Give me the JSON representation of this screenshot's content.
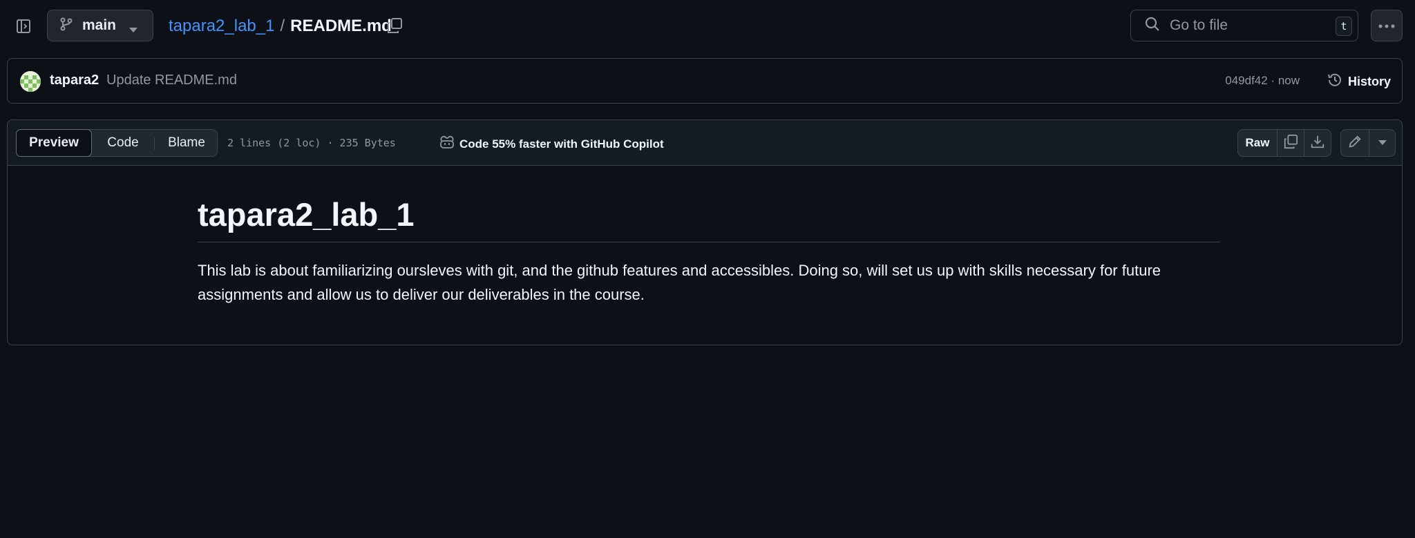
{
  "topbar": {
    "branch": "main",
    "repo_name": "tapara2_lab_1",
    "separator": "/",
    "file_name": "README.md",
    "goto_placeholder": "Go to file",
    "goto_shortcut": "t"
  },
  "commit": {
    "author": "tapara2",
    "message": "Update README.md",
    "sha": "049df42",
    "meta_separator": " · ",
    "time": "now",
    "history_label": "History"
  },
  "file_header": {
    "tabs": [
      {
        "label": "Preview",
        "active": true
      },
      {
        "label": "Code",
        "active": false
      },
      {
        "label": "Blame",
        "active": false
      }
    ],
    "stats": "2 lines (2 loc) · 235 Bytes",
    "copilot_cta": "Code 55% faster with GitHub Copilot",
    "raw_label": "Raw"
  },
  "readme": {
    "title": "tapara2_lab_1",
    "paragraph": "This lab is about familiarizing oursleves with git, and the github features and accessibles. Doing so, will set us up with skills necessary for future assignments and allow us to deliver our deliverables in the course."
  },
  "icons": {
    "sidebar_toggle": "sidebar-expand-icon",
    "branch": "git-branch-icon",
    "copy_path": "copy-icon",
    "search": "search-icon",
    "more": "kebab-horizontal-icon",
    "history": "history-icon",
    "copilot": "copilot-icon",
    "copy_raw": "copy-icon",
    "download": "download-icon",
    "edit": "pencil-icon",
    "edit_menu": "triangle-down-icon"
  },
  "colors": {
    "background": "#0d1117",
    "link": "#4493f8",
    "border": "#3d444d",
    "muted_text": "#9198a1",
    "text": "#f0f6fc"
  }
}
